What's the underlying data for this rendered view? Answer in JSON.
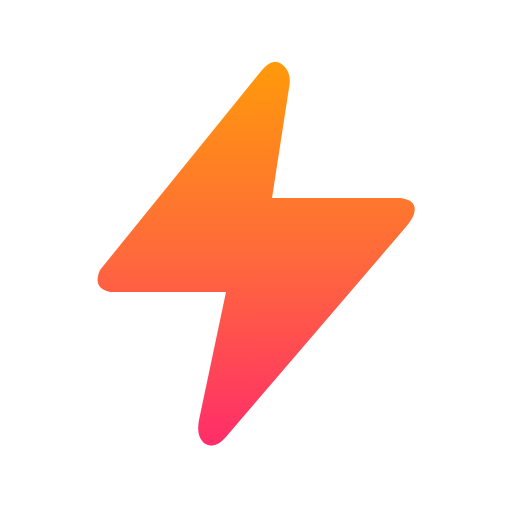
{
  "icon": {
    "name": "lightning-bolt-icon",
    "colors": {
      "gradient_top": "#FF9A0A",
      "gradient_middle": "#FF6A3A",
      "gradient_bottom": "#FF2D6A",
      "background": "#FFFFFF"
    }
  }
}
